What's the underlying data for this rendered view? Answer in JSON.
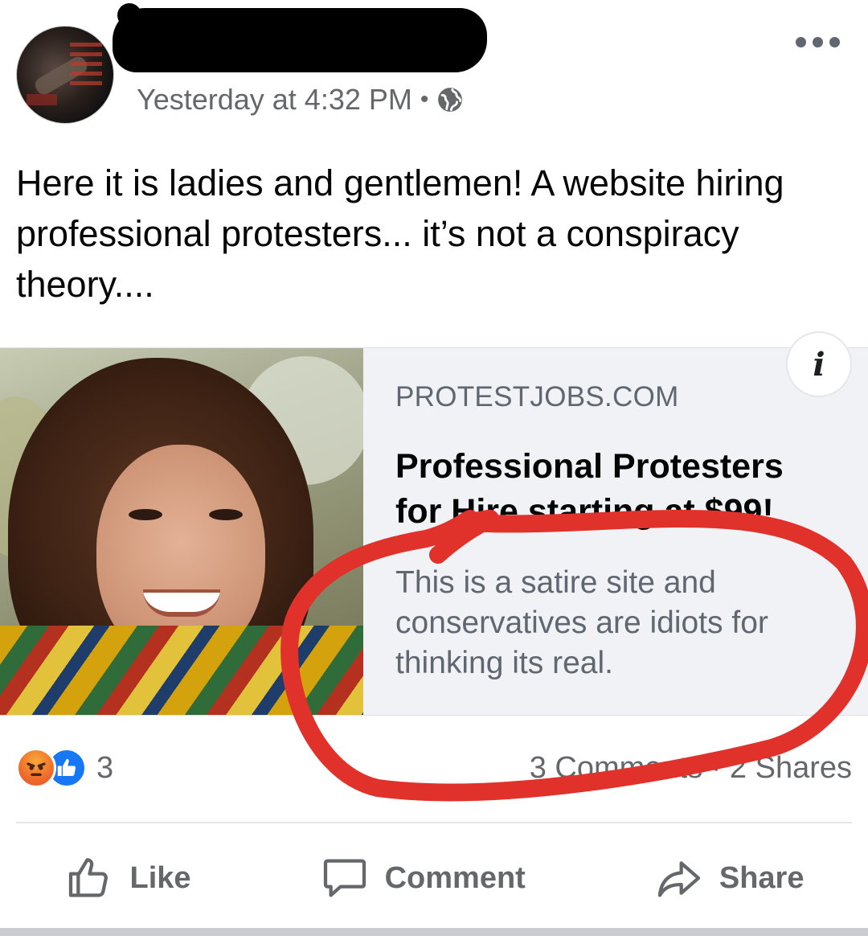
{
  "post": {
    "timestamp": "Yesterday at 4:32 PM",
    "separator": "•",
    "privacy_icon": "globe-icon",
    "more_icon": "more-options-icon",
    "text": "Here it is ladies and gentlemen! A website hiring professional protesters... it’s not a conspiracy theory...."
  },
  "link_card": {
    "domain": "PROTESTJOBS.COM",
    "title_line1": "Professional Protesters",
    "title_line2": "for Hire starting at $99!",
    "description": "This is a satire site and conservatives are idiots for thinking its real.",
    "info_label": "i"
  },
  "stats": {
    "reaction_count": "3",
    "comments_shares": "3 Comments · 2 Shares",
    "reaction_icons": [
      "angry-reaction-icon",
      "like-reaction-icon"
    ]
  },
  "actions": {
    "like": "Like",
    "comment": "Comment",
    "share": "Share"
  },
  "colors": {
    "annotation_red": "#e0312b",
    "facebook_blue": "#1877f2",
    "secondary_text": "#65676b"
  }
}
